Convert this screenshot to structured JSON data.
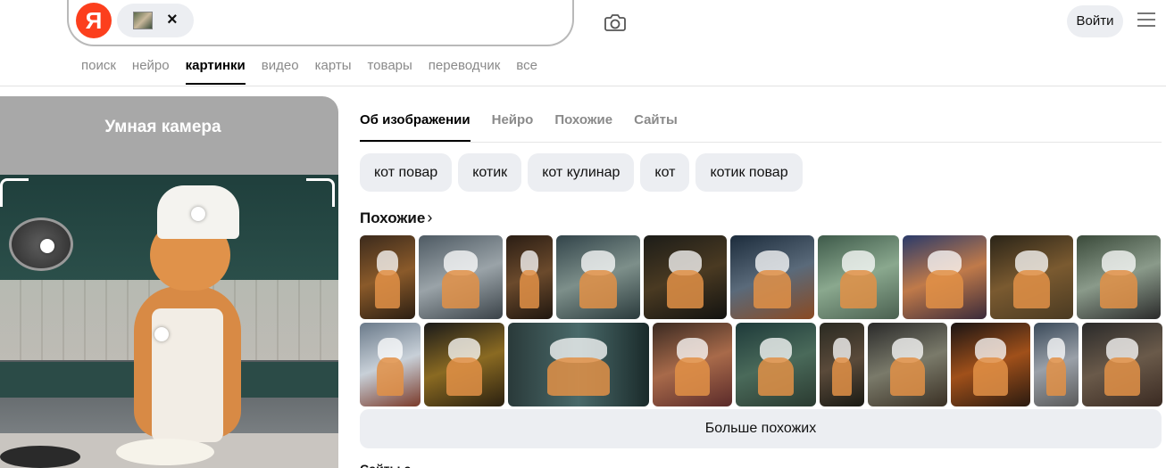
{
  "header": {
    "logo_text": "Я",
    "chip_close": "×",
    "login_label": "Войти"
  },
  "nav": {
    "items": [
      {
        "label": "поиск",
        "active": false
      },
      {
        "label": "нейро",
        "active": false
      },
      {
        "label": "картинки",
        "active": true
      },
      {
        "label": "видео",
        "active": false
      },
      {
        "label": "карты",
        "active": false
      },
      {
        "label": "товары",
        "active": false
      },
      {
        "label": "переводчик",
        "active": false
      },
      {
        "label": "все",
        "active": false
      }
    ]
  },
  "left_panel": {
    "title": "Умная камера"
  },
  "right_panel": {
    "tabs": [
      {
        "label": "Об изображении",
        "active": true
      },
      {
        "label": "Нейро",
        "active": false
      },
      {
        "label": "Похожие",
        "active": false
      },
      {
        "label": "Сайты",
        "active": false
      }
    ],
    "tags": [
      "кот повар",
      "котик",
      "кот кулинар",
      "кот",
      "котик повар"
    ],
    "similar_heading": "Похожие",
    "similar_chevron": "›",
    "more_button": "Больше похожих",
    "cut_text": "Сайты с"
  },
  "colors": {
    "brand": "#fc3f1d",
    "chip_bg": "#eceef2",
    "panel_grey": "#a8a8a8"
  },
  "icons": {
    "camera": "camera-icon",
    "menu": "hamburger-menu-icon"
  }
}
